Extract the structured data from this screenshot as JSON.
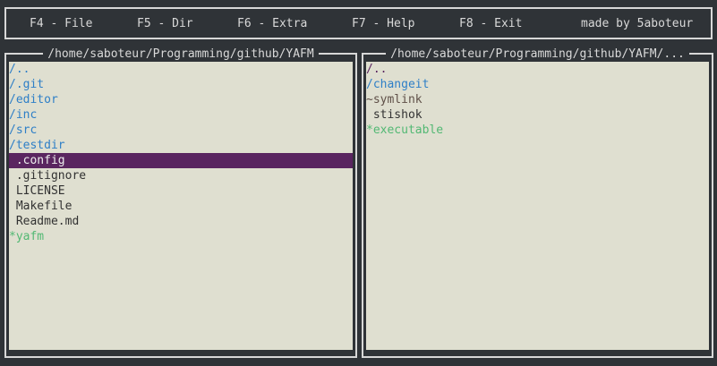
{
  "menu": {
    "f4": "F4 - File",
    "f5": "F5 - Dir",
    "f6": "F6 - Extra",
    "f7": "F7 - Help",
    "f8": "F8 - Exit",
    "credit": "made by 5aboteur"
  },
  "left_panel": {
    "title": "/home/saboteur/Programming/github/YAFM",
    "items": [
      {
        "text": "/..",
        "kind": "dir"
      },
      {
        "text": "/.git",
        "kind": "dir"
      },
      {
        "text": "/editor",
        "kind": "dir"
      },
      {
        "text": "/inc",
        "kind": "dir"
      },
      {
        "text": "/src",
        "kind": "dir"
      },
      {
        "text": "/testdir",
        "kind": "dir"
      },
      {
        "text": " .config",
        "kind": "file",
        "selected": true
      },
      {
        "text": " .gitignore",
        "kind": "file"
      },
      {
        "text": " LICENSE",
        "kind": "file"
      },
      {
        "text": " Makefile",
        "kind": "file"
      },
      {
        "text": " Readme.md",
        "kind": "file"
      },
      {
        "text": "*yafm",
        "kind": "exec"
      }
    ]
  },
  "right_panel": {
    "title": "/home/saboteur/Programming/github/YAFM/...",
    "items": [
      {
        "text": "/..",
        "kind": "up"
      },
      {
        "text": "/changeit",
        "kind": "dir"
      },
      {
        "text": "~symlink",
        "kind": "link"
      },
      {
        "text": " stishok",
        "kind": "file"
      },
      {
        "text": "*executable",
        "kind": "exec"
      }
    ]
  },
  "colors": {
    "background": "#2f3337",
    "panel_background": "#dfdfd0",
    "selection": "#5a2560",
    "directory": "#2e7fc7",
    "executable": "#52b873",
    "symlink": "#5f5048",
    "file": "#323232"
  }
}
